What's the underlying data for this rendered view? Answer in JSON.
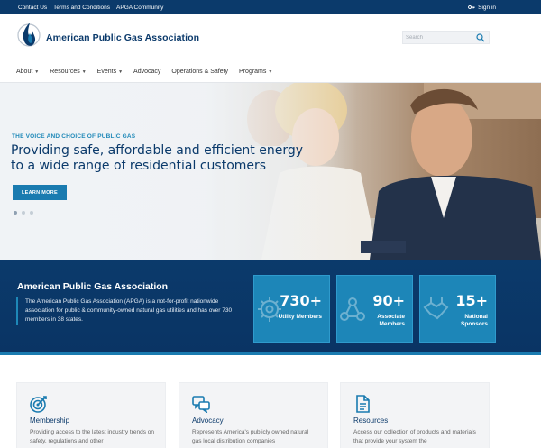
{
  "topbar": {
    "links": [
      "Contact Us",
      "Terms and Conditions",
      "APGA Community"
    ],
    "signin_label": "Sign in"
  },
  "header": {
    "brand": "American Public Gas Association",
    "search_placeholder": "Search"
  },
  "nav": {
    "items": [
      {
        "label": "About",
        "dropdown": true
      },
      {
        "label": "Resources",
        "dropdown": true
      },
      {
        "label": "Events",
        "dropdown": true
      },
      {
        "label": "Advocacy",
        "dropdown": false
      },
      {
        "label": "Operations & Safety",
        "dropdown": false
      },
      {
        "label": "Programs",
        "dropdown": true
      }
    ]
  },
  "hero": {
    "eyebrow": "THE VOICE AND CHOICE OF PUBLIC GAS",
    "headline": "Providing safe, affordable and efficient energy to a wide range of residential customers",
    "cta_label": "LEARN MORE",
    "slides": 3,
    "active_slide": 1
  },
  "about": {
    "title": "American Public Gas Association",
    "description": "The American Public Gas Association (APGA) is a not-for-profit nationwide association for public & community-owned natural gas utilities and has over 730 members in 38 states."
  },
  "stats": [
    {
      "value": "730+",
      "label": "Utility Members",
      "icon": "gear-icon"
    },
    {
      "value": "90+",
      "label": "Associate Members",
      "icon": "network-icon"
    },
    {
      "value": "15+",
      "label": "National Sponsors",
      "icon": "handshake-icon"
    }
  ],
  "cards": [
    {
      "title": "Membership",
      "desc": "Providing access to the latest industry trends on safety, regulations and other",
      "icon": "target-icon"
    },
    {
      "title": "Advocacy",
      "desc": "Represents America's publicly owned natural gas local distribution companies",
      "icon": "chat-bubbles-icon"
    },
    {
      "title": "Resources",
      "desc": "Access our collection of products and materials that provide your system the",
      "icon": "document-icon"
    }
  ],
  "colors": {
    "navy": "#0b3a6b",
    "accent": "#1a7bb0",
    "stat_tile": "#1d86b8"
  }
}
